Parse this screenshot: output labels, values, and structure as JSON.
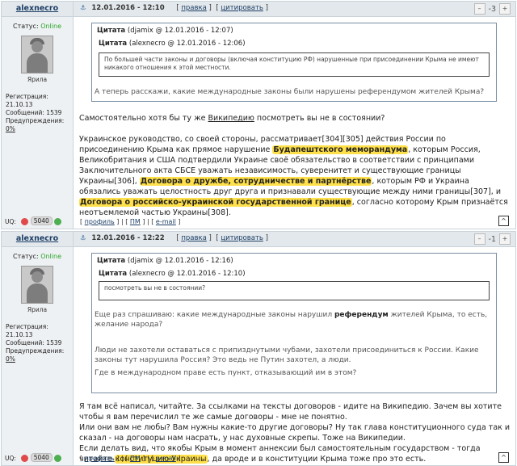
{
  "post1": {
    "username": "alexnecro",
    "status_label": "Статус:",
    "status_value": "Online",
    "avatar_caption": "Ярила",
    "stats": {
      "reg_label": "Регистрация:",
      "reg_value": "21.10.13",
      "msgs_label": "Сообщений:",
      "msgs_value": "1539",
      "warn_label": "Предупреждения:",
      "warn_value": "0%"
    },
    "uq_label": "UQ:",
    "uq_score": "5040",
    "date": "12.01.2016 - 12:10",
    "edit_label": "правка",
    "cite_label": "цитировать",
    "rating": "-3",
    "quote": {
      "label": "Цитата",
      "meta": "(djamix @ 12.01.2016 - 12:07)",
      "inner_label": "Цитата",
      "inner_meta": "(alexnecro @ 12.01.2016 - 12:06)",
      "inner_text": "По большей части законы и договоры (включая конституцию РФ) нарушенные при присоединении Крыма не имеют никакого отношения к этой местности.",
      "reply": "А теперь расскажи, какие международные законы были нарушены референдумом жителей Крыма?"
    },
    "body": {
      "p1_a": "Самостоятельно хотя бы ту же ",
      "p1_link": "Википедию",
      "p1_b": " посмотреть вы не в состоянии?",
      "p2_a": "Украинское руководство, со своей стороны, рассматривает[304][305] действия России по присоединению Крыма как прямое нарушение ",
      "p2_hl1": "Будапештского меморандума",
      "p2_b": ", которым Россия, Великобритания и США подтвердили Украине своё обязательство в соответствии с принципами Заключительного акта СБСЕ уважать независимость, суверенитет и существующие границы Украины[306], ",
      "p2_hl2": "Договора о дружбе, сотрудничестве и партнёрстве",
      "p2_c": ", которым РФ и Украина обязались уважать целостность друг друга и признавали существующие между ними границы[307], и ",
      "p2_hl3": "Договора о российско-украинской государственной границе",
      "p2_d": ", согласно которому Крым признаётся неотъемлемой частью Украины[308]."
    },
    "footer": {
      "profile": "профиль",
      "pm": "ПМ",
      "email": "e-mail"
    }
  },
  "post2": {
    "username": "alexnecro",
    "status_label": "Статус:",
    "status_value": "Online",
    "avatar_caption": "Ярила",
    "stats": {
      "reg_label": "Регистрация:",
      "reg_value": "21.10.13",
      "msgs_label": "Сообщений:",
      "msgs_value": "1539",
      "warn_label": "Предупреждения:",
      "warn_value": "0%"
    },
    "uq_label": "UQ:",
    "uq_score": "5040",
    "date": "12.01.2016 - 12:22",
    "edit_label": "правка",
    "cite_label": "цитировать",
    "rating": "-1",
    "quote": {
      "label": "Цитата",
      "meta": "(djamix @ 12.01.2016 - 12:16)",
      "inner_label": "Цитата",
      "inner_meta": "(alexnecro @ 12.01.2016 - 12:10)",
      "inner_text": "посмотреть вы не в состоянии?",
      "reply1_a": "Еще раз спрашиваю: какие международные законы нарушил ",
      "reply1_b": "референдум",
      "reply1_c": " жителей Крыма, то есть, желание народа?",
      "reply2": "Люди не захотели оставаться с припизднутыми чубами, захотели присоединиться к России. Какие законы тут нарушила Россия? Это ведь не Путин захотел, а люди.",
      "reply3": "Где в международном праве есть пункт, отказывающий им в этом?"
    },
    "body": {
      "l1": "Я там всё написал, читайте. За ссылками на тексты договоров - идите на Википедию. Зачем вы хотите чтобы я вам перечислил те же самые договоры - мне не понятно.",
      "l2": "Или они вам не любы? Вам нужны какие-то другие договоры? Ну так глава конституционного суда так и сказал - на договоры нам насрать, у нас духовные скрепы. Тоже на Википедии.",
      "l3_a": "Если делать вид, что якобы Крым в момент аннексии был самостоятельным государством - тогда читайте ",
      "l3_hl": "конституцию Украины",
      "l3_b": ", да вроде и в конституции Крыма тоже про это есть."
    },
    "footer": {
      "profile": "профиль",
      "pm": "ПМ",
      "email": "e-mail"
    }
  }
}
